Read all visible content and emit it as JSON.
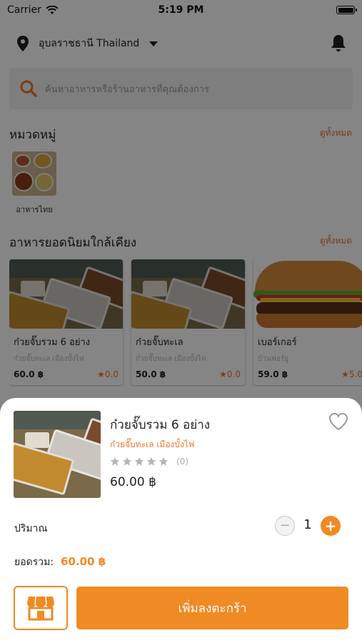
{
  "status_bar": {
    "carrier": "Carrier",
    "time": "5:19 PM"
  },
  "header": {
    "location": "อุบลราชธานี Thailand"
  },
  "search": {
    "placeholder": "ค้นหาอาหารหรือร้านอาหารที่คุณต้องการ"
  },
  "categories_section": {
    "title": "หมวดหมู่",
    "see_all": "ดูทั้งหมด",
    "items": [
      {
        "label": "อาหารไทย"
      }
    ]
  },
  "popular_section": {
    "title": "อาหารยอดนิยมใกล้เคียง",
    "see_all": "ดูทั้งหมด",
    "items": [
      {
        "name": "ก๋วยจั๊บรวม 6 อย่าง",
        "shop": "ก๋วยจั๊บทะเล เมืองบั้งไฟ",
        "price": "60.0 ฿",
        "rating": "★0.0"
      },
      {
        "name": "ก๋วยจั๊บทะเล",
        "shop": "ก๋วยจั๊บทะเล เมืองบั้งไฟ",
        "price": "50.0 ฿",
        "rating": "★0.0"
      },
      {
        "name": "เบอร์เกอร์",
        "shop": "บ้านฟอร์ยู",
        "price": "59.0 ฿",
        "rating": "★5.0"
      }
    ]
  },
  "sheet": {
    "product_name": "ก๋วยจั๊บรวม 6 อย่าง",
    "shop_name": "ก๋วยจั๊บทะเล เมืองบั้งไฟ",
    "rating_stars": 0,
    "rating_count": "(0)",
    "price": "60.00 ฿",
    "quantity_label": "ปริมาณ",
    "minus": "−",
    "quantity": "1",
    "plus": "+",
    "total_label": "ยอดรวม:",
    "total_value": "60.00 ฿",
    "add_to_cart": "เพิ่มลงตะกร้า"
  },
  "colors": {
    "accent": "#f08a24",
    "overlay": "rgba(0,0,0,0.48)"
  }
}
